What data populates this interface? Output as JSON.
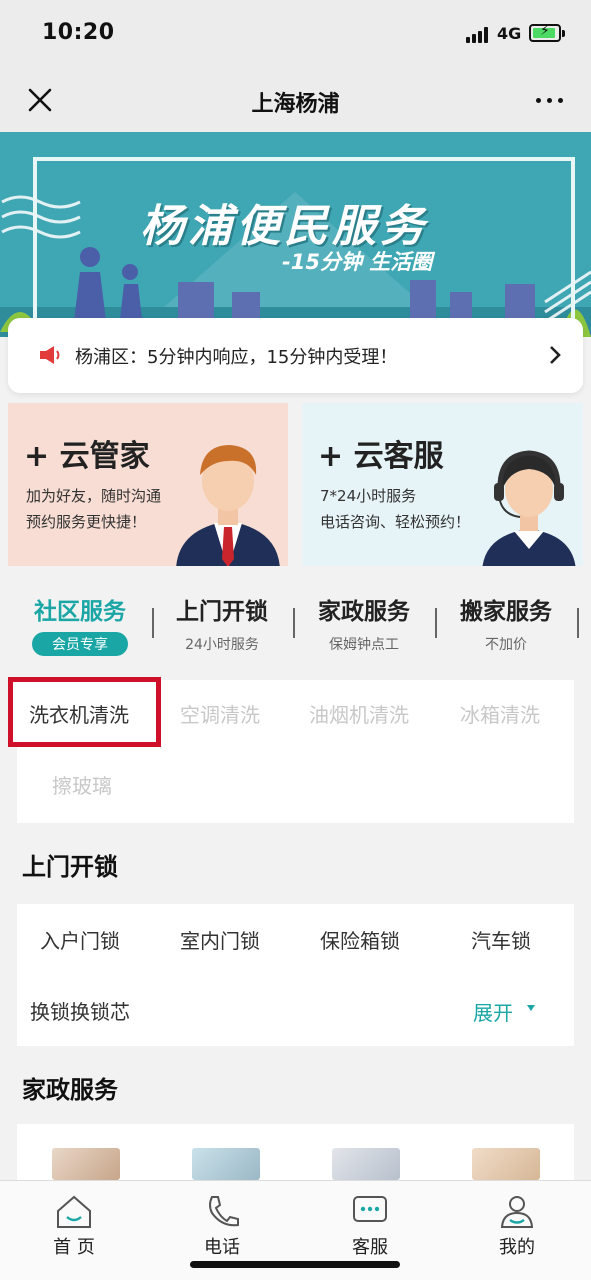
{
  "status_bar": {
    "time": "10:20",
    "network": "4G"
  },
  "navbar": {
    "title": "上海杨浦"
  },
  "banner": {
    "title": "杨浦便民服务",
    "subtitle": "-15分钟 生活圈"
  },
  "notice": {
    "text": "杨浦区：5分钟内响应，15分钟内受理！"
  },
  "promo": {
    "left": {
      "title": "+ 云管家",
      "line1": "加为好友，随时沟通",
      "line2": "预约服务更快捷！"
    },
    "right": {
      "title": "+ 云客服",
      "line1": "7*24小时服务",
      "line2": "电话咨询、轻松预约！"
    }
  },
  "service_tabs": [
    {
      "title": "社区服务",
      "badge": "会员专享"
    },
    {
      "title": "上门开锁",
      "sub": "24小时服务"
    },
    {
      "title": "家政服务",
      "sub": "保姆钟点工"
    },
    {
      "title": "搬家服务",
      "sub": "不加价"
    }
  ],
  "community_options": [
    "洗衣机清洗",
    "空调清洗",
    "油烟机清洗",
    "冰箱清洗",
    "擦玻璃"
  ],
  "locksmith": {
    "title": "上门开锁",
    "options": [
      "入户门锁",
      "室内门锁",
      "保险箱锁",
      "汽车锁",
      "换锁换锁芯"
    ],
    "expand_label": "展开"
  },
  "housekeeping": {
    "title": "家政服务"
  },
  "tabbar": [
    "首 页",
    "电话",
    "客服",
    "我的"
  ],
  "colors": {
    "accent": "#1ba6a6",
    "highlight_border": "#d0102a",
    "banner_bg": "#3fa6b3"
  }
}
